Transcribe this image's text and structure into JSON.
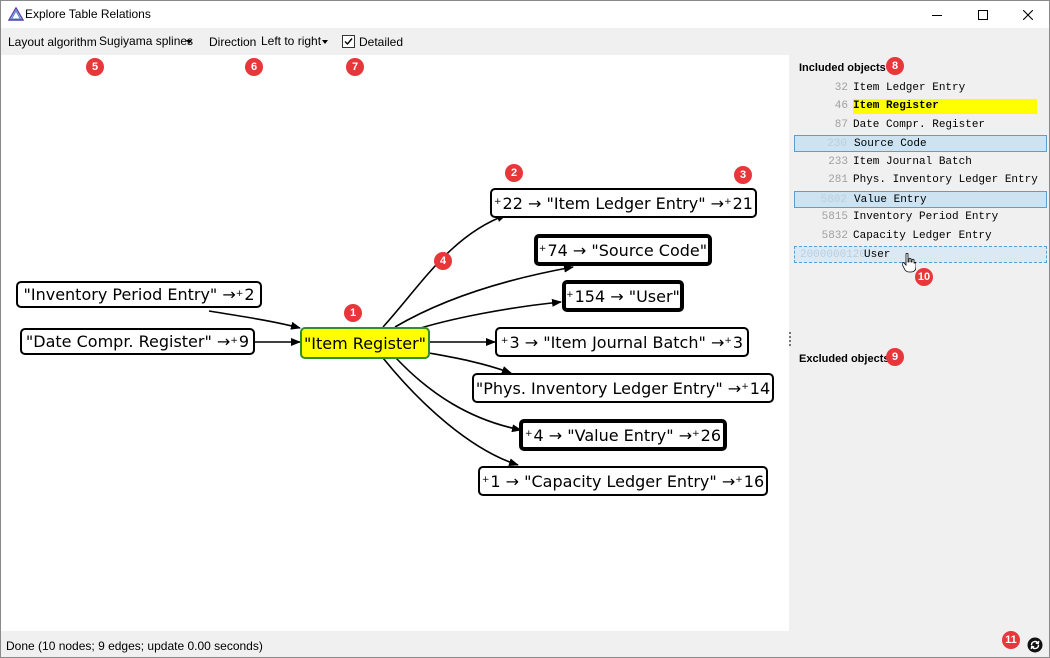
{
  "window": {
    "title": "Explore Table Relations",
    "controls": [
      "minimize-icon",
      "maximize-icon",
      "close-icon"
    ]
  },
  "toolbar": {
    "layout_label": "Layout algorithm",
    "layout_value": "Sugiyama splines",
    "direction_label": "Direction",
    "direction_value": "Left to right",
    "detailed_label": "Detailed",
    "detailed_checked": true
  },
  "badges": [
    "1",
    "2",
    "3",
    "4",
    "5",
    "6",
    "7",
    "8",
    "9",
    "10",
    "11"
  ],
  "graph": {
    "nodes": {
      "root": "\"Item Register\"",
      "inv_period": {
        "text": "\"Inventory Period Entry\" → ",
        "sup": "+",
        "tail": "2"
      },
      "date_compr": {
        "text": "\"Date Compr. Register\" → ",
        "sup": "+",
        "tail": "9"
      },
      "item_ledger": {
        "pre_sup": "+",
        "pre": "22 → \"Item Ledger Entry\" → ",
        "sup": "+",
        "tail": "21"
      },
      "source_code": {
        "pre_sup": "+",
        "pre": "74 → \"Source Code\""
      },
      "user": {
        "pre_sup": "+",
        "pre": "154 → \"User\""
      },
      "journal_batch": {
        "pre_sup": "+",
        "pre": "3 → \"Item Journal Batch\" → ",
        "sup": "+",
        "tail": "3"
      },
      "phys_inventory": {
        "pre": "\"Phys. Inventory Ledger Entry\" → ",
        "sup": "+",
        "tail": "14"
      },
      "value_entry": {
        "pre_sup": "+",
        "pre": "4 → \"Value Entry\" → ",
        "sup": "+",
        "tail": "26"
      },
      "capacity": {
        "pre_sup": "+",
        "pre": "1 → \"Capacity Ledger Entry\" → ",
        "sup": "+",
        "tail": "16"
      }
    }
  },
  "panel": {
    "included_heading": "Included objects",
    "excluded_heading": "Excluded objects",
    "included": [
      {
        "id": "32",
        "name": "Item Ledger Entry"
      },
      {
        "id": "46",
        "name": "Item Register"
      },
      {
        "id": "87",
        "name": "Date Compr. Register"
      },
      {
        "id": "230",
        "name": "Source Code"
      },
      {
        "id": "233",
        "name": "Item Journal Batch"
      },
      {
        "id": "281",
        "name": "Phys. Inventory Ledger Entry"
      },
      {
        "id": "5802",
        "name": "Value Entry"
      },
      {
        "id": "5815",
        "name": "Inventory Period Entry"
      },
      {
        "id": "5832",
        "name": "Capacity Ledger Entry"
      },
      {
        "id": "2000000120",
        "name": "User"
      }
    ]
  },
  "status": {
    "text": "Done (10 nodes; 9 edges; update 0.00 seconds)"
  },
  "colors": {
    "badge": "#e8373a",
    "root_fill": "#ffff00",
    "root_border": "#2f8f2f",
    "selection": "#cde3f1",
    "highlight": "#ffff00"
  }
}
